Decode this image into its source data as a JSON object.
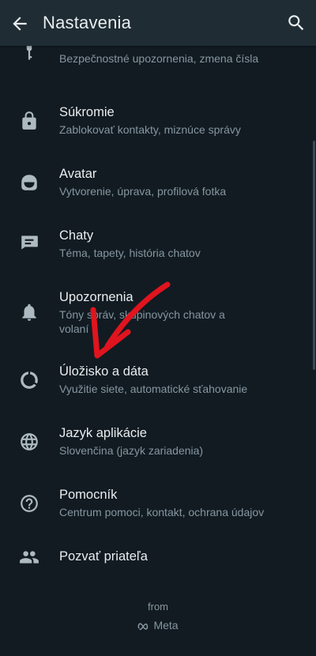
{
  "appbar": {
    "title": "Nastavenia",
    "back_icon": "arrow-back-icon",
    "search_icon": "search-icon"
  },
  "settings": {
    "account": {
      "subtitle": "Bezpečnostné upozornenia, zmena čísla",
      "icon": "key-icon"
    },
    "privacy": {
      "title": "Súkromie",
      "subtitle": "Zablokovať kontakty, miznúce správy",
      "icon": "lock-icon"
    },
    "avatar": {
      "title": "Avatar",
      "subtitle": "Vytvorenie, úprava, profilová fotka",
      "icon": "avatar-icon"
    },
    "chats": {
      "title": "Chaty",
      "subtitle": "Téma, tapety, história chatov",
      "icon": "chat-icon"
    },
    "notifications": {
      "title": "Upozornenia",
      "subtitle": "Tóny správ, skupinových chatov a volaní",
      "icon": "bell-icon"
    },
    "storage": {
      "title": "Úložisko a dáta",
      "subtitle": "Využitie siete, automatické sťahovanie",
      "icon": "data-usage-icon"
    },
    "language": {
      "title": "Jazyk aplikácie",
      "subtitle": "Slovenčina (jazyk zariadenia)",
      "icon": "globe-icon"
    },
    "help": {
      "title": "Pomocník",
      "subtitle": "Centrum pomoci, kontakt, ochrana údajov",
      "icon": "help-icon"
    },
    "invite": {
      "title": "Pozvať priateľa",
      "icon": "people-icon"
    }
  },
  "footer": {
    "from": "from",
    "brand": "Meta"
  },
  "colors": {
    "background": "#121b22",
    "appbar": "#1f2c34",
    "primary_text": "#e9edef",
    "secondary_text": "#8696a0",
    "icon": "#aebac1",
    "annotation_arrow": "#e0141e"
  }
}
